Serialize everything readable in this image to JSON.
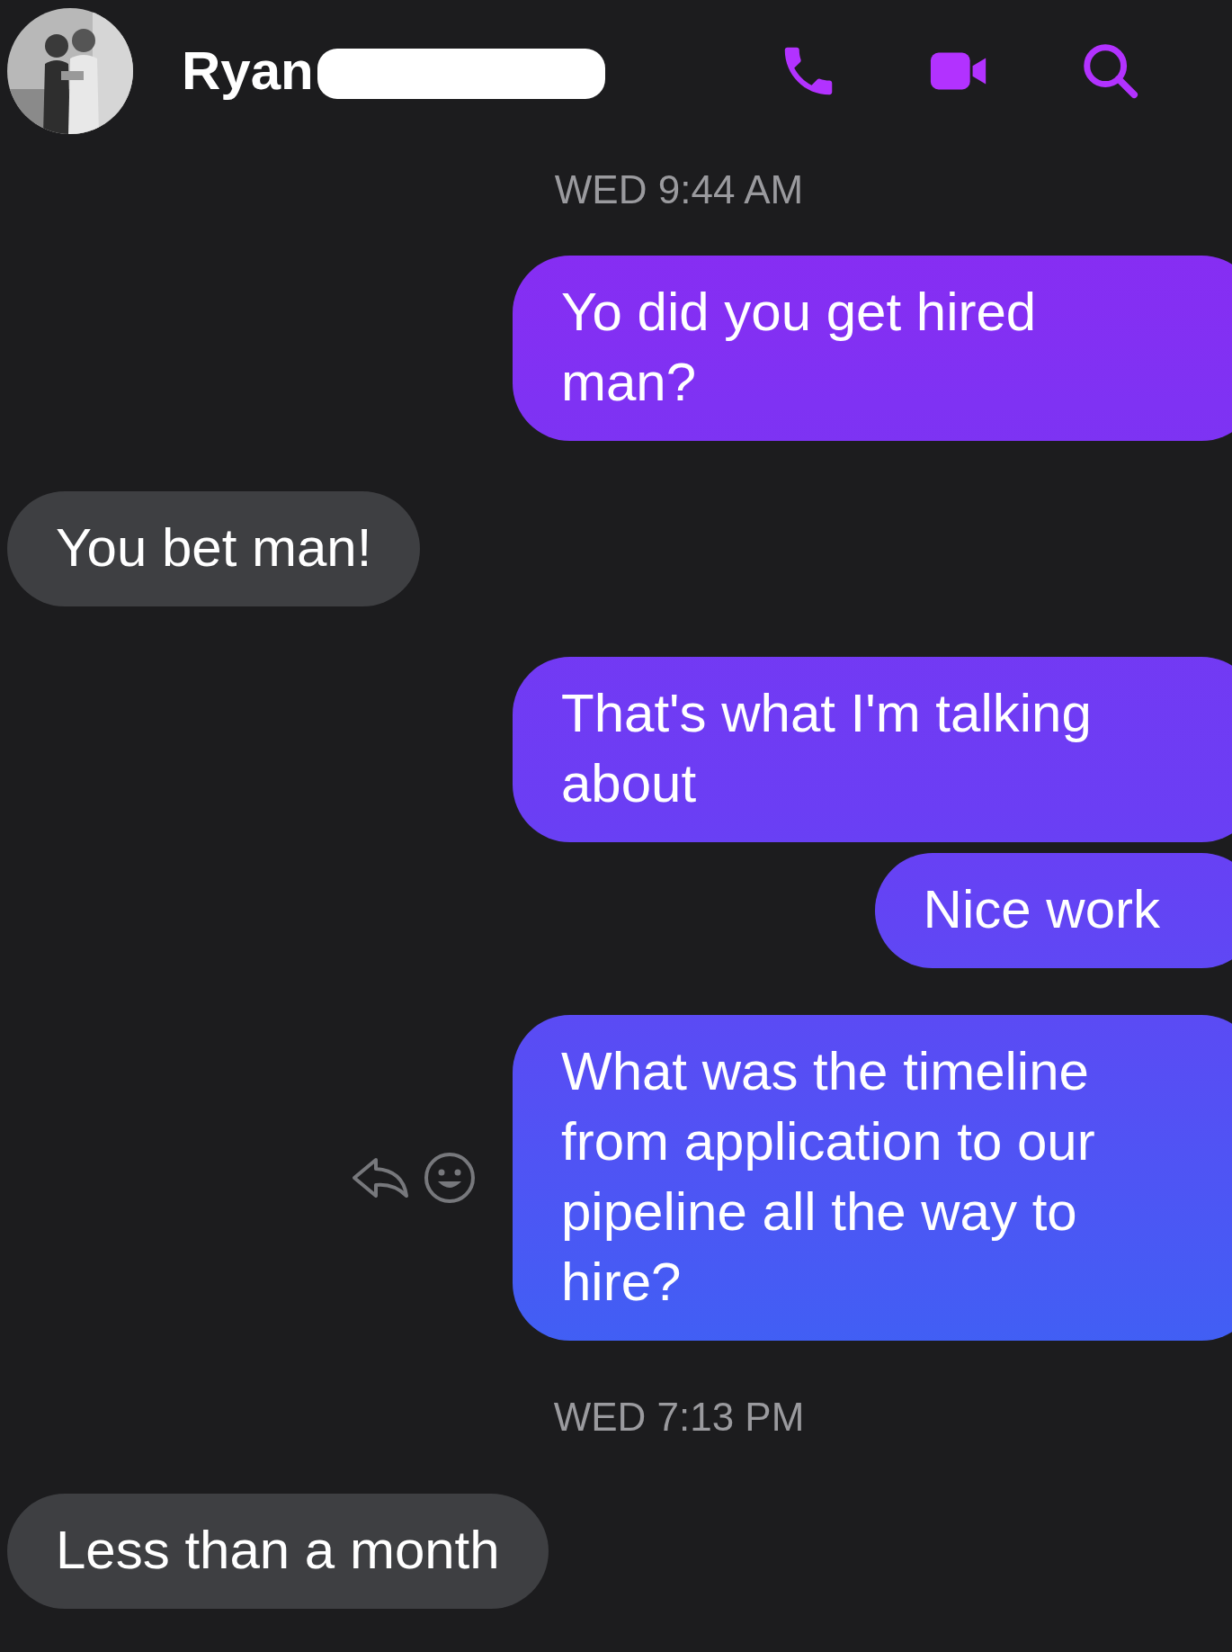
{
  "header": {
    "contact_name": "Ryan",
    "name_redacted": true
  },
  "messages": [
    {
      "kind": "timestamp",
      "text": "WED 9:44 AM"
    },
    {
      "kind": "sent",
      "text": "Yo did you get hired man?",
      "show_actions": false
    },
    {
      "kind": "received",
      "text": "You bet man!",
      "show_actions": false
    },
    {
      "kind": "sent",
      "text": "That's what I'm talking about",
      "show_actions": false
    },
    {
      "kind": "sent",
      "text": "Nice work",
      "show_actions": false
    },
    {
      "kind": "sent",
      "text": "What was the timeline from application to our pipeline all the way to hire?",
      "show_actions": true
    },
    {
      "kind": "timestamp",
      "text": "WED 7:13 PM"
    },
    {
      "kind": "received",
      "text": "Less than a month",
      "show_actions": false
    }
  ]
}
